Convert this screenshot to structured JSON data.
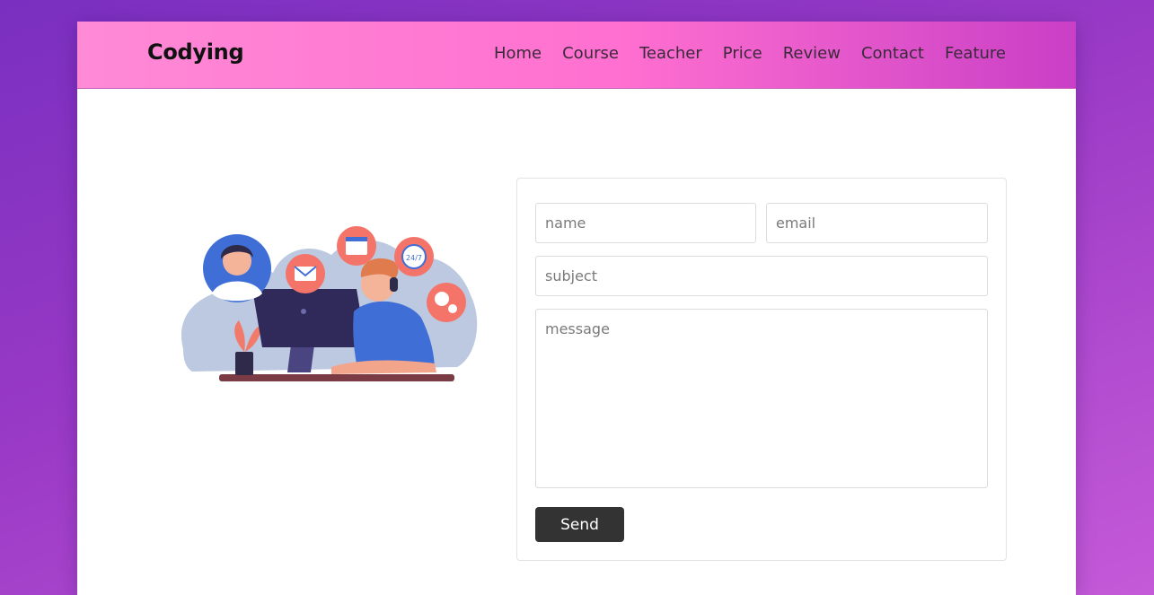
{
  "header": {
    "logo": "Codying",
    "nav": [
      "Home",
      "Course",
      "Teacher",
      "Price",
      "Review",
      "Contact",
      "Feature"
    ]
  },
  "illustration": {
    "badge_24_7": "24/7"
  },
  "contact_form": {
    "name_placeholder": "name",
    "email_placeholder": "email",
    "subject_placeholder": "subject",
    "message_placeholder": "message",
    "send_label": "Send"
  },
  "colors": {
    "background": "#8e35c4",
    "header_gradient_start": "#ff8ad6",
    "header_gradient_end": "#c93fc6",
    "button": "#333333",
    "icon_circle": "#f4746a"
  }
}
